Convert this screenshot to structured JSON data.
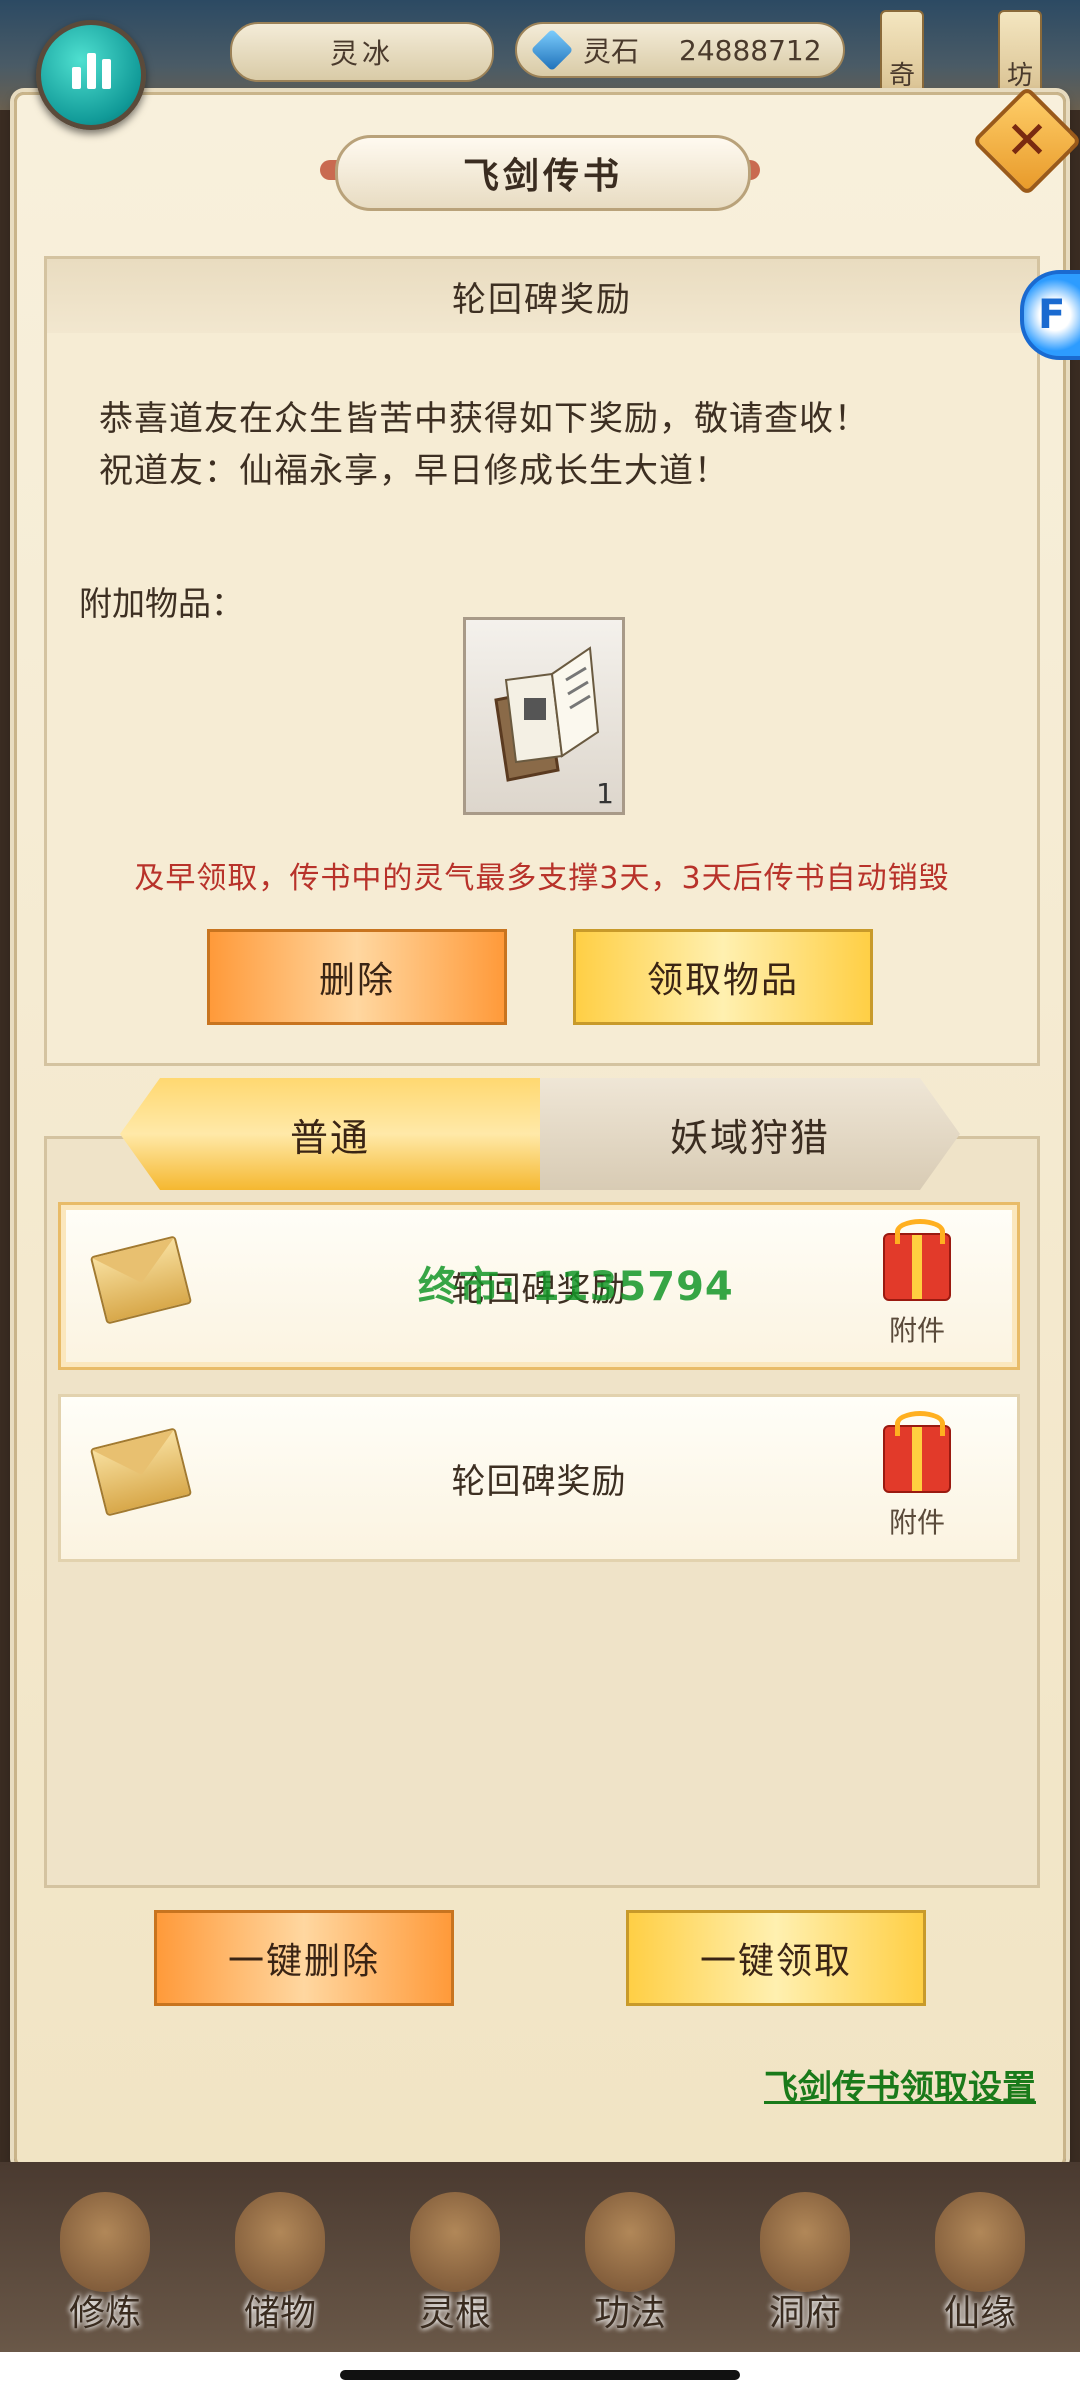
{
  "topbar": {
    "player_name": "灵冰",
    "currency_label": "灵石",
    "currency_value": "24888712",
    "banner_left": "奇",
    "banner_right": "坊"
  },
  "dialog": {
    "title": "飞剑传书",
    "detail": {
      "heading": "轮回碑奖励",
      "line1": "恭喜道友在众生皆苦中获得如下奖励，敬请查收！",
      "line2": "祝道友：仙福永享，早日修成长生大道！",
      "attach_label": "附加物品：",
      "item": {
        "icon": "book-icon",
        "count": "1"
      },
      "warning": "及早领取，传书中的灵气最多支撑3天，3天后传书自动销毁",
      "delete_label": "删除",
      "claim_label": "领取物品"
    },
    "tabs": [
      {
        "label": "普通",
        "active": true
      },
      {
        "label": "妖域狩猎",
        "active": false
      }
    ],
    "mails": [
      {
        "title": "轮回碑奖励",
        "attachment_label": "附件",
        "selected": true
      },
      {
        "title": "轮回碑奖励",
        "attachment_label": "附件",
        "selected": false
      }
    ],
    "delete_all_label": "一键删除",
    "claim_all_label": "一键领取",
    "settings_link": "飞剑传书领取设置"
  },
  "watermark": "终市: 1135794",
  "side_tab_letter": "F",
  "bottom_nav": [
    {
      "label": "修炼"
    },
    {
      "label": "储物"
    },
    {
      "label": "灵根"
    },
    {
      "label": "功法"
    },
    {
      "label": "洞府"
    },
    {
      "label": "仙缘"
    }
  ],
  "colors": {
    "warning": "#b8322a",
    "link": "#1a7a1a",
    "watermark": "#14962a"
  }
}
